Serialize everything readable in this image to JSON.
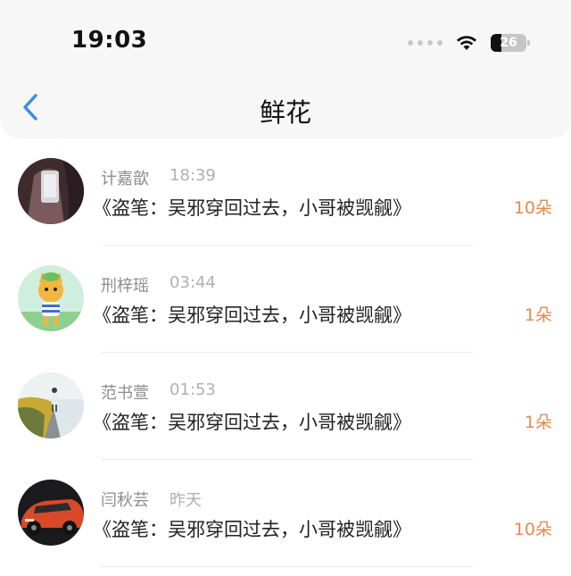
{
  "status_bar": {
    "time": "19:03",
    "battery": "26"
  },
  "header": {
    "title": "鲜花"
  },
  "items": [
    {
      "name": "计嘉歆",
      "time": "18:39",
      "book": "《盗笔：吴邪穿回过去，小哥被觊觎》",
      "amount": "10朵"
    },
    {
      "name": "刑梓瑶",
      "time": "03:44",
      "book": "《盗笔：吴邪穿回过去，小哥被觊觎》",
      "amount": "1朵"
    },
    {
      "name": "范书萱",
      "time": "01:53",
      "book": "《盗笔：吴邪穿回过去，小哥被觊觎》",
      "amount": "1朵"
    },
    {
      "name": "闫秋芸",
      "time": "昨天",
      "book": "《盗笔：吴邪穿回过去，小哥被觊觎》",
      "amount": "10朵"
    }
  ],
  "colors": {
    "accent": "#e8894e",
    "back_icon": "#3a8ee6"
  }
}
